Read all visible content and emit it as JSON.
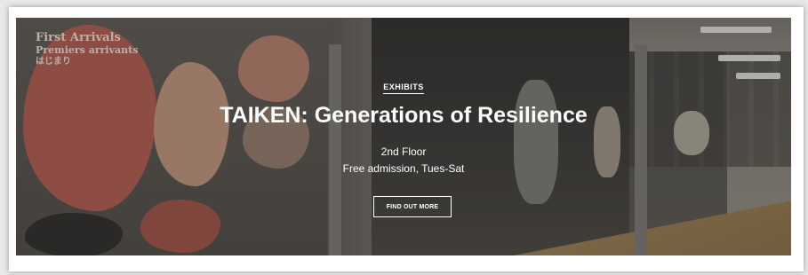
{
  "hero": {
    "eyebrow": "EXHIBITS",
    "title": "TAIKEN: Generations of Resilience",
    "line1": "2nd Floor",
    "line2": "Free admission, Tues-Sat",
    "cta_label": "FIND OUT MORE"
  },
  "background_panel_text": {
    "heading_en": "First Arrivals",
    "heading_fr": "Premiers arrivants",
    "heading_jp": "はじまり"
  },
  "colors": {
    "text": "#ffffff",
    "overlay": "rgba(0,0,0,0.28)"
  }
}
